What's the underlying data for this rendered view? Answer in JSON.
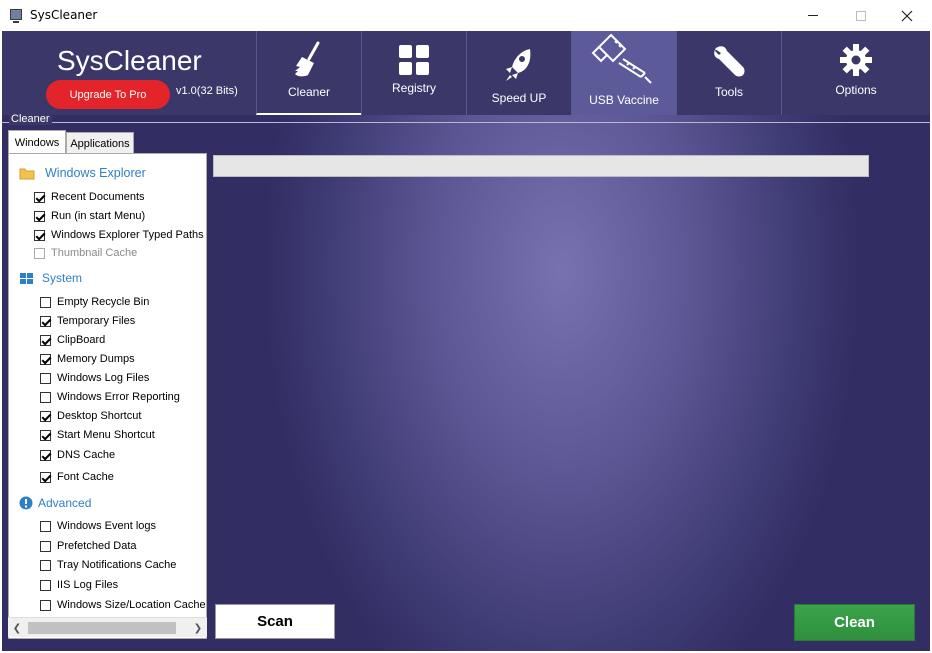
{
  "window": {
    "title": "SysCleaner"
  },
  "header": {
    "brand": "SysCleaner",
    "upgrade_label": "Upgrade To Pro",
    "version": "v1.0(32 Bits)",
    "nav": [
      {
        "label": "Cleaner",
        "icon": "broom-icon"
      },
      {
        "label": "Registry",
        "icon": "grid-icon"
      },
      {
        "label": "Speed UP",
        "icon": "rocket-icon"
      },
      {
        "label": "USB Vaccine",
        "icon": "usb-syringe-icon"
      },
      {
        "label": "Tools",
        "icon": "wrench-icon"
      },
      {
        "label": "Options",
        "icon": "gear-icon"
      }
    ]
  },
  "section": {
    "label": "Cleaner"
  },
  "tabs": {
    "windows": "Windows",
    "applications": "Applications"
  },
  "groups": {
    "explorer": {
      "title": "Windows Explorer",
      "items": [
        {
          "label": "Recent Documents",
          "checked": true
        },
        {
          "label": "Run (in start Menu)",
          "checked": true
        },
        {
          "label": "Windows Explorer Typed Paths",
          "checked": true
        },
        {
          "label": "Thumbnail Cache",
          "checked": false
        }
      ]
    },
    "system": {
      "title": "System",
      "items": [
        {
          "label": "Empty Recycle Bin",
          "checked": false
        },
        {
          "label": "Temporary Files",
          "checked": true
        },
        {
          "label": "ClipBoard",
          "checked": true
        },
        {
          "label": "Memory Dumps",
          "checked": true
        },
        {
          "label": "Windows Log Files",
          "checked": false
        },
        {
          "label": "Windows Error Reporting",
          "checked": false
        },
        {
          "label": "Desktop Shortcut",
          "checked": true
        },
        {
          "label": "Start Menu Shortcut",
          "checked": true
        },
        {
          "label": "DNS Cache",
          "checked": true
        },
        {
          "label": "Font Cache",
          "checked": true
        }
      ]
    },
    "advanced": {
      "title": "Advanced",
      "items": [
        {
          "label": "Windows Event logs",
          "checked": false
        },
        {
          "label": "Prefetched Data",
          "checked": false
        },
        {
          "label": "Tray Notifications Cache",
          "checked": false
        },
        {
          "label": "IIS Log Files",
          "checked": false
        },
        {
          "label": "Windows Size/Location Cache",
          "checked": false
        }
      ]
    }
  },
  "progress": {
    "value": 0
  },
  "actions": {
    "scan": "Scan",
    "clean": "Clean"
  }
}
